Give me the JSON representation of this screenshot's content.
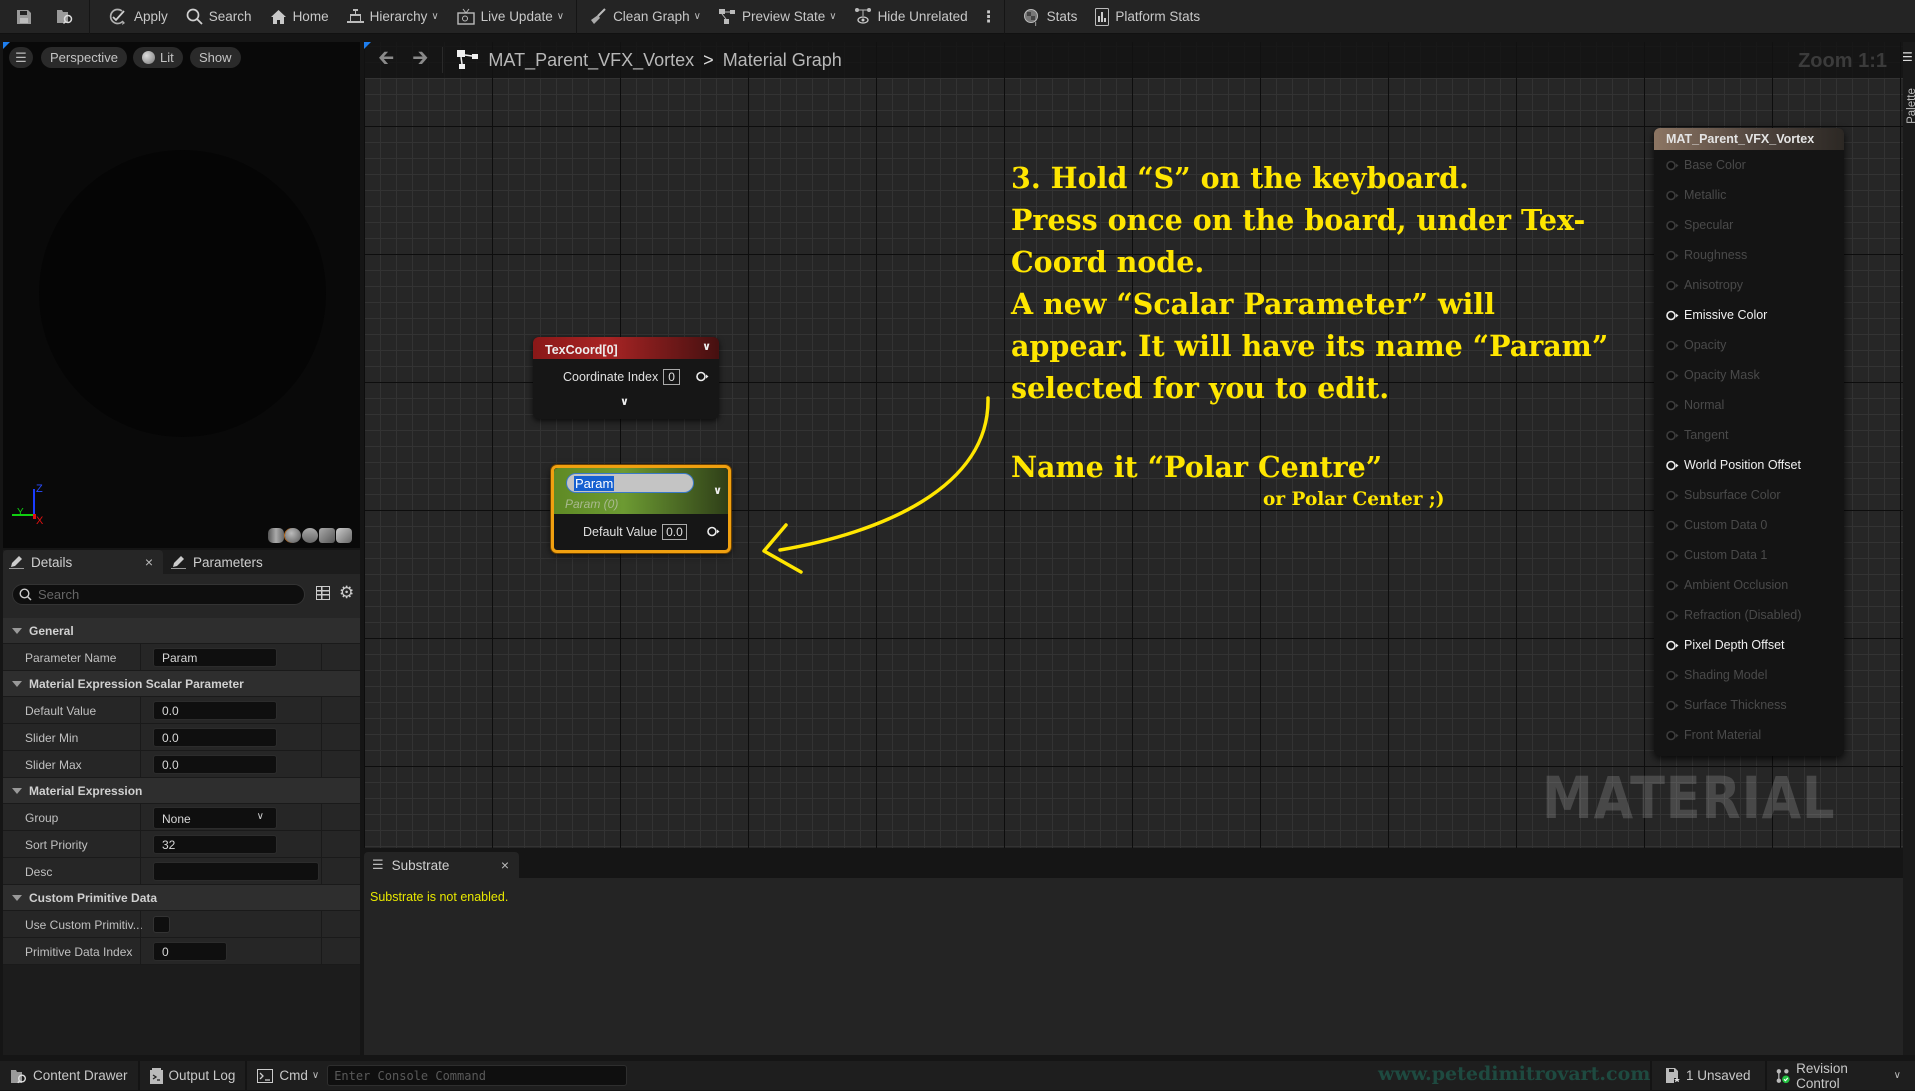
{
  "toolbar": {
    "save_icon": "save-icon",
    "browse_icon": "browse-icon",
    "apply": "Apply",
    "search": "Search",
    "home": "Home",
    "hierarchy": "Hierarchy",
    "live_update": "Live Update",
    "clean_graph": "Clean Graph",
    "preview_state": "Preview State",
    "hide_unrelated": "Hide Unrelated",
    "stats": "Stats",
    "platform_stats": "Platform Stats"
  },
  "viewport": {
    "perspective": "Perspective",
    "lit": "Lit",
    "show": "Show",
    "axes": {
      "z": "Z",
      "y": "Y",
      "x": "X"
    }
  },
  "details": {
    "tabs": [
      {
        "label": "Details"
      },
      {
        "label": "Parameters"
      }
    ],
    "search_placeholder": "Search",
    "categories": [
      {
        "name": "General",
        "props": [
          {
            "label": "Parameter Name",
            "value": "Param"
          }
        ]
      },
      {
        "name": "Material Expression Scalar Parameter",
        "props": [
          {
            "label": "Default Value",
            "value": "0.0"
          },
          {
            "label": "Slider Min",
            "value": "0.0"
          },
          {
            "label": "Slider Max",
            "value": "0.0"
          }
        ]
      },
      {
        "name": "Material Expression",
        "props": [
          {
            "label": "Group",
            "value": "None"
          },
          {
            "label": "Sort Priority",
            "value": "32"
          },
          {
            "label": "Desc",
            "value": ""
          }
        ]
      },
      {
        "name": "Custom Primitive Data",
        "props": [
          {
            "label": "Use Custom Primitiv...",
            "checked": false
          },
          {
            "label": "Primitive Data Index",
            "value": "0"
          }
        ]
      }
    ]
  },
  "graph": {
    "breadcrumb": {
      "asset": "MAT_Parent_VFX_Vortex",
      "separator": ">",
      "page": "Material Graph"
    },
    "zoom": "Zoom 1:1",
    "palette": "Palette",
    "watermark": "MATERIAL",
    "texcoord_node": {
      "title": "TexCoord[0]",
      "pin_label": "Coordinate Index",
      "pin_value": "0"
    },
    "param_node": {
      "name": "Param",
      "subtitle": "Param (0)",
      "pin_label": "Default Value",
      "pin_value": "0.0"
    },
    "result_node": {
      "title": "MAT_Parent_VFX_Vortex",
      "pins": [
        {
          "label": "Base Color",
          "active": false
        },
        {
          "label": "Metallic",
          "active": false
        },
        {
          "label": "Specular",
          "active": false
        },
        {
          "label": "Roughness",
          "active": false
        },
        {
          "label": "Anisotropy",
          "active": false
        },
        {
          "label": "Emissive Color",
          "active": true
        },
        {
          "label": "Opacity",
          "active": false
        },
        {
          "label": "Opacity Mask",
          "active": false
        },
        {
          "label": "Normal",
          "active": false
        },
        {
          "label": "Tangent",
          "active": false
        },
        {
          "label": "World Position Offset",
          "active": true
        },
        {
          "label": "Subsurface Color",
          "active": false
        },
        {
          "label": "Custom Data 0",
          "active": false
        },
        {
          "label": "Custom Data 1",
          "active": false
        },
        {
          "label": "Ambient Occlusion",
          "active": false
        },
        {
          "label": "Refraction (Disabled)",
          "active": false
        },
        {
          "label": "Pixel Depth Offset",
          "active": true
        },
        {
          "label": "Shading Model",
          "active": false
        },
        {
          "label": "Surface Thickness",
          "active": false
        },
        {
          "label": "Front Material",
          "active": false
        }
      ]
    }
  },
  "annotation": {
    "lines": [
      "3. Hold “S” on the keyboard.",
      "Press once on the board, under Tex-",
      "Coord node.",
      "A new “Scalar Parameter” will",
      "appear. It will have its name “Param”",
      "selected for you to edit."
    ],
    "name_line": "Name it “Polar Centre”",
    "alt_line": "or Polar Center ;)",
    "color": "#ffe600"
  },
  "substrate": {
    "tab": "Substrate",
    "message": "Substrate is not enabled."
  },
  "statusbar": {
    "content_drawer": "Content Drawer",
    "output_log": "Output Log",
    "cmd": "Cmd",
    "console_placeholder": "Enter Console Command",
    "website": "www.petedimitrovart.com",
    "unsaved": "1 Unsaved",
    "revision_control": "Revision Control"
  }
}
